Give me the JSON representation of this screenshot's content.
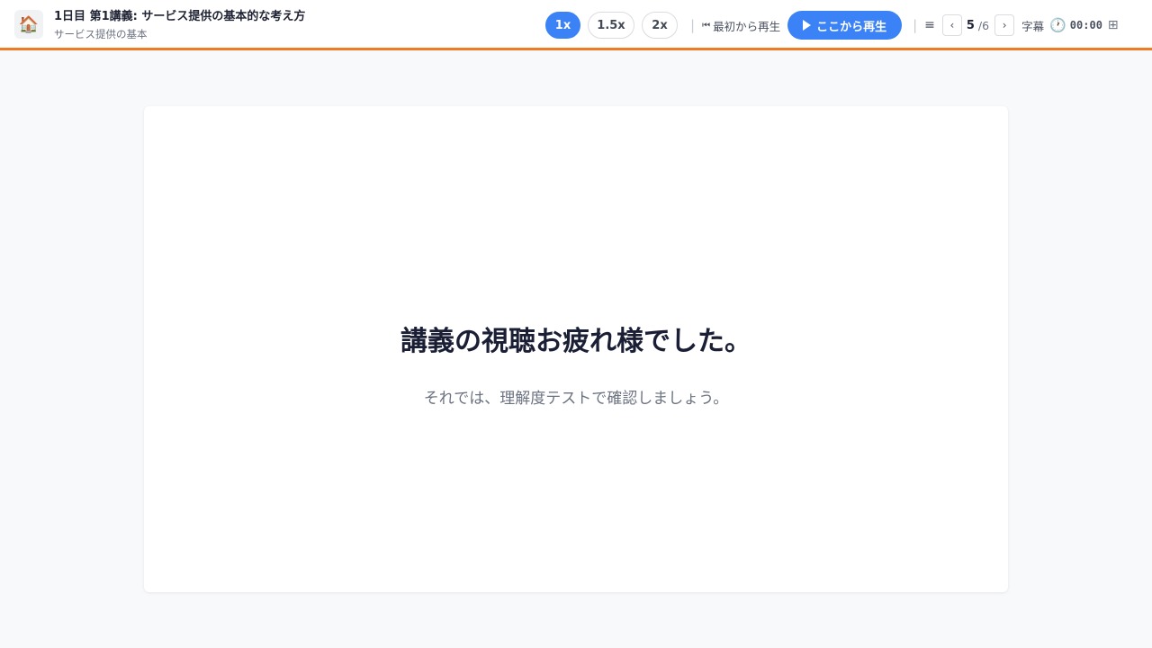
{
  "header": {
    "home_icon": "house-icon",
    "home_glyph": "🏠",
    "title": "1日目 第1講義: サービス提供の基本的な考え方",
    "subtitle": "サービス提供の基本"
  },
  "controls": {
    "speeds": [
      "1x",
      "1.5x",
      "2x"
    ],
    "active_speed": "1x",
    "separator": "|",
    "restart_icon": "⏮",
    "restart_label": "最初から再生",
    "play_label": "ここから再生",
    "menu_glyph": "≡",
    "prev_glyph": "‹",
    "next_glyph": "›",
    "current_page": "5",
    "total_pages": "/6",
    "subtitles_label": "字幕",
    "clock_glyph": "🕐",
    "time": "00:00",
    "grid_glyph": "⊞"
  },
  "slide": {
    "heading": "講義の視聴お疲れ様でした。",
    "text": "それでは、理解度テストで確認しましょう。"
  },
  "colors": {
    "accent": "#3b82f6",
    "header_border": "#ef7a22"
  }
}
